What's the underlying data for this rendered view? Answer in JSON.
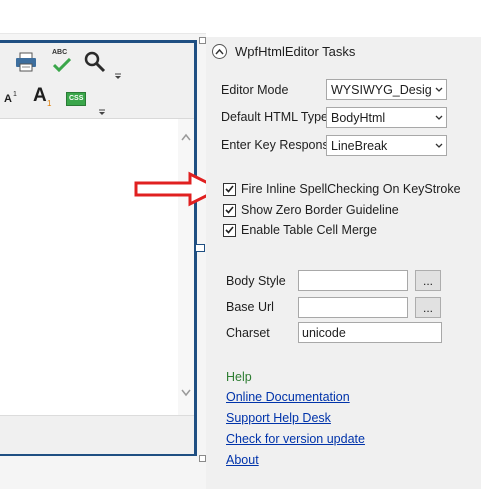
{
  "tasks_panel": {
    "title": "WpfHtmlEditor Tasks",
    "editor_mode": {
      "label": "Editor Mode",
      "value": "WYSIWYG_Design"
    },
    "default_html_type": {
      "label": "Default HTML Type",
      "value": "BodyHtml"
    },
    "enter_key_response": {
      "label": "Enter Key Response",
      "value": "LineBreak"
    },
    "checkboxes": [
      {
        "label": "Fire Inline SpellChecking On KeyStroke",
        "checked": true
      },
      {
        "label": "Show Zero Border Guideline",
        "checked": true
      },
      {
        "label": "Enable Table Cell Merge",
        "checked": true
      }
    ],
    "body_style": {
      "label": "Body Style",
      "value": "",
      "button": "..."
    },
    "base_url": {
      "label": "Base Url",
      "value": "",
      "button": "..."
    },
    "charset": {
      "label": "Charset",
      "value": "unicode"
    },
    "help": {
      "heading": "Help",
      "links": [
        "Online Documentation",
        "Support Help Desk",
        "Check for version update",
        "About"
      ]
    }
  },
  "toolbar": {
    "row1_icons": [
      "print-icon",
      "spellcheck-icon",
      "find-icon"
    ],
    "row2_icons": [
      "superscript-icon",
      "subscript-icon",
      "css-icon"
    ],
    "spell_text": "ABC",
    "font_glyph": "A",
    "super_mark": "1",
    "css_text": "CSS"
  },
  "colors": {
    "frame_border": "#1f4f82",
    "annotation_arrow": "#e02020",
    "link": "#0033aa",
    "help_heading": "#2e7d32",
    "check_green": "#3aa64a"
  }
}
